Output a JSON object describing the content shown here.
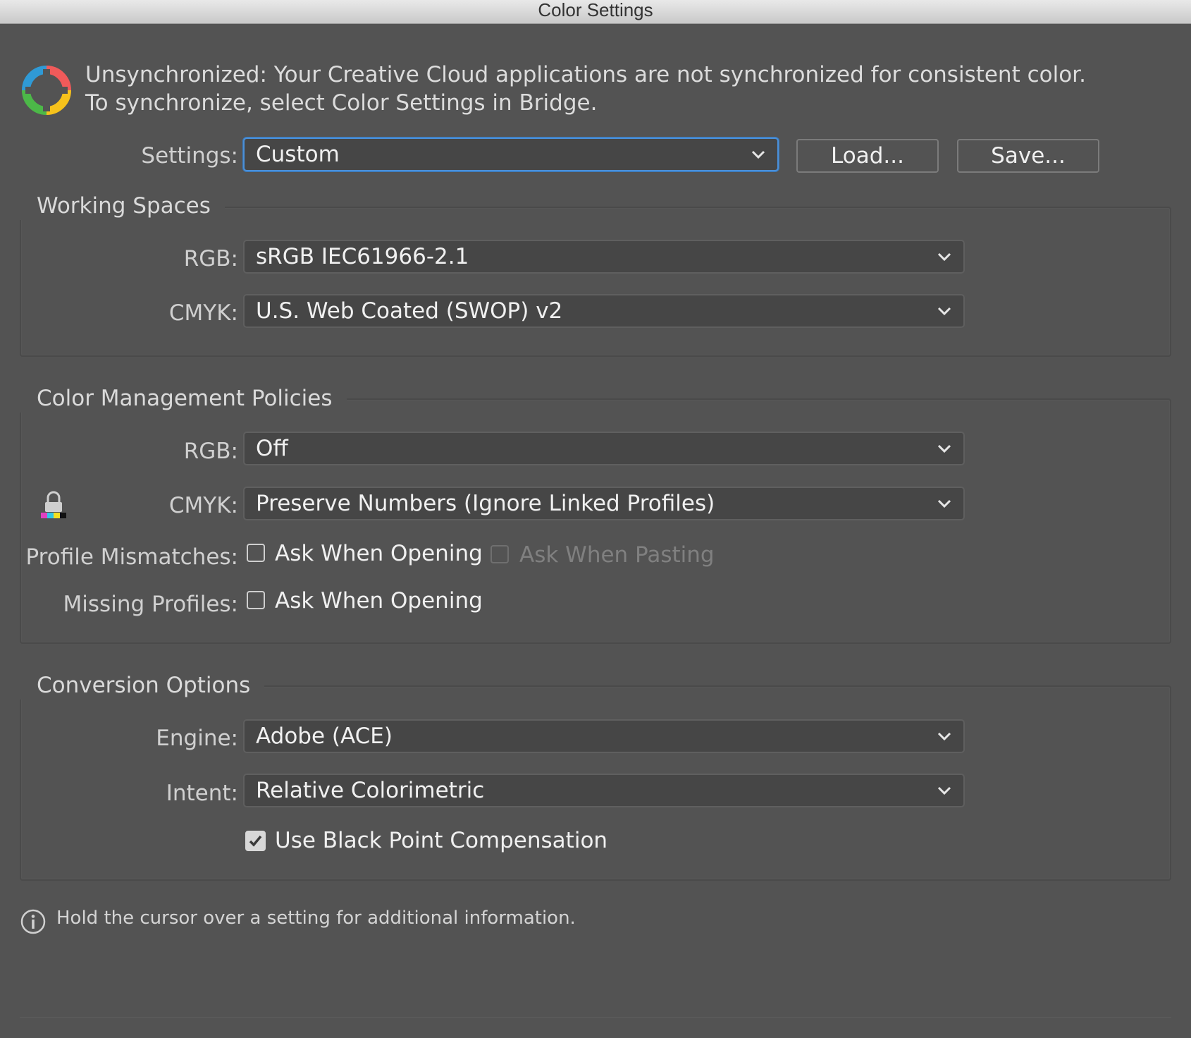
{
  "window": {
    "title": "Color Settings"
  },
  "sync": {
    "message": "Unsynchronized: Your Creative Cloud applications are not synchronized for consistent color. To synchronize, select Color Settings in Bridge.",
    "icon": "color-sync-icon"
  },
  "settings": {
    "label": "Settings:",
    "value": "Custom",
    "load_label": "Load...",
    "save_label": "Save..."
  },
  "working_spaces": {
    "title": "Working Spaces",
    "rgb_label": "RGB:",
    "rgb_value": "sRGB IEC61966-2.1",
    "cmyk_label": "CMYK:",
    "cmyk_value": "U.S. Web Coated (SWOP) v2"
  },
  "policies": {
    "title": "Color Management Policies",
    "rgb_label": "RGB:",
    "rgb_value": "Off",
    "cmyk_label": "CMYK:",
    "cmyk_value": "Preserve Numbers (Ignore Linked Profiles)",
    "mismatch_label": "Profile Mismatches:",
    "mismatch_opening": "Ask When Opening",
    "mismatch_opening_checked": false,
    "mismatch_pasting": "Ask When Pasting",
    "mismatch_pasting_checked": false,
    "missing_label": "Missing Profiles:",
    "missing_opening": "Ask When Opening",
    "missing_opening_checked": false
  },
  "conversion": {
    "title": "Conversion Options",
    "engine_label": "Engine:",
    "engine_value": "Adobe (ACE)",
    "intent_label": "Intent:",
    "intent_value": "Relative Colorimetric",
    "bpc_label": "Use Black Point Compensation",
    "bpc_checked": true
  },
  "hint": {
    "text": "Hold the cursor over a setting for additional information."
  },
  "colors": {
    "background": "#535353",
    "focus": "#4a90d9",
    "field": "#464646"
  }
}
